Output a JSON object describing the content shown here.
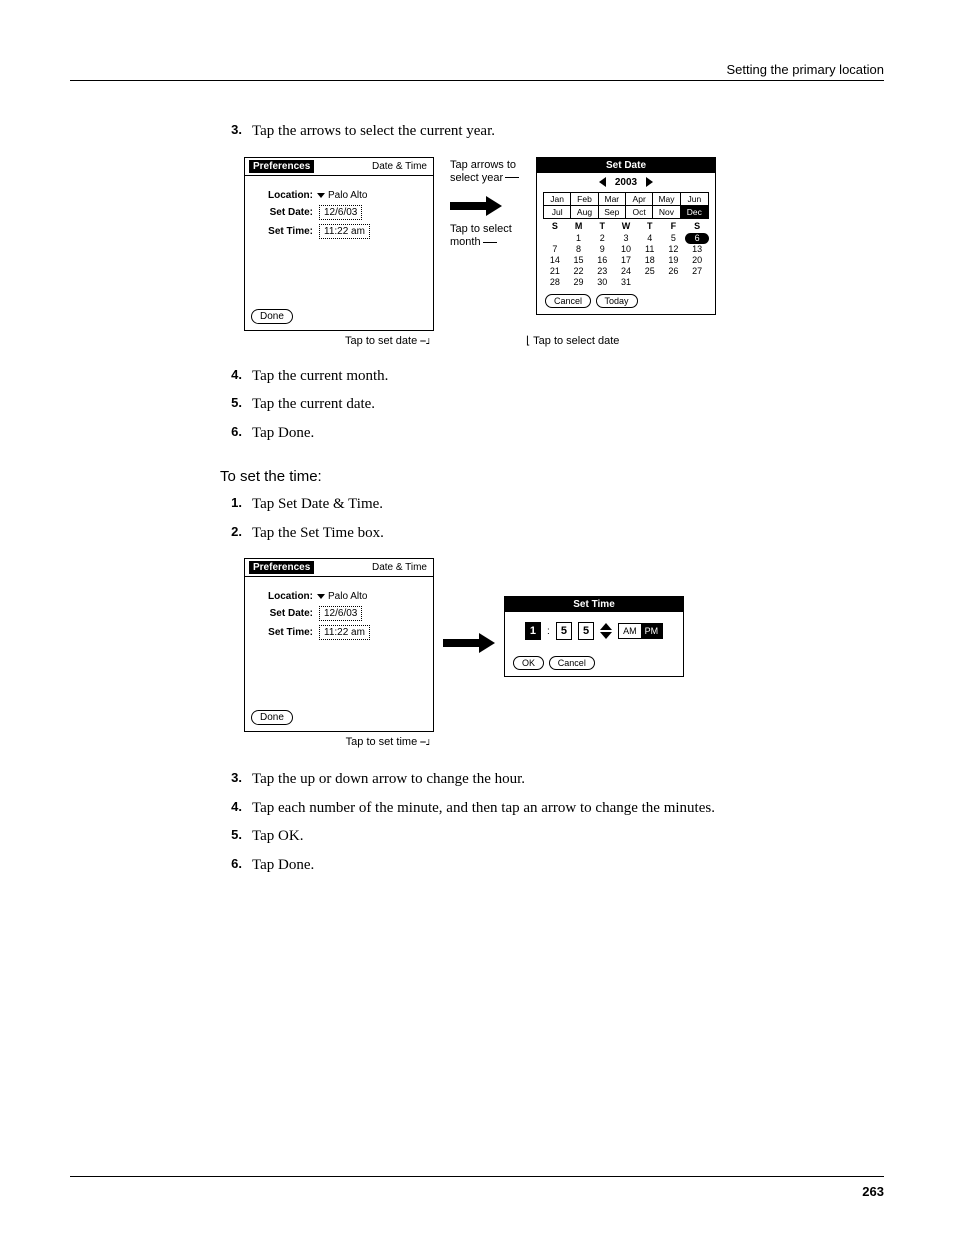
{
  "header": {
    "section": "Setting the primary location"
  },
  "steps_a": [
    {
      "n": "3.",
      "t": "Tap the arrows to select the current year."
    }
  ],
  "fig1": {
    "pref_title_left": "Preferences",
    "pref_title_right": "Date & Time",
    "location_label": "Location:",
    "location_value": "Palo Alto",
    "setdate_label": "Set Date:",
    "setdate_value": "12/6/03",
    "settime_label": "Set Time:",
    "settime_value": "11:22 am",
    "done": "Done",
    "callout_year": "Tap arrows to select year",
    "callout_month": "Tap to select month",
    "caption_left": "Tap to set date",
    "caption_right": "Tap to select date",
    "setdate_title": "Set Date",
    "year": "2003",
    "months": [
      "Jan",
      "Feb",
      "Mar",
      "Apr",
      "May",
      "Jun",
      "Jul",
      "Aug",
      "Sep",
      "Oct",
      "Nov",
      "Dec"
    ],
    "selected_month_index": 11,
    "dow": [
      "S",
      "M",
      "T",
      "W",
      "T",
      "F",
      "S"
    ],
    "calendar_rows": [
      [
        "",
        "1",
        "2",
        "3",
        "4",
        "5",
        "6"
      ],
      [
        "7",
        "8",
        "9",
        "10",
        "11",
        "12",
        "13"
      ],
      [
        "14",
        "15",
        "16",
        "17",
        "18",
        "19",
        "20"
      ],
      [
        "21",
        "22",
        "23",
        "24",
        "25",
        "26",
        "27"
      ],
      [
        "28",
        "29",
        "30",
        "31",
        "",
        "",
        ""
      ]
    ],
    "highlight_day": "6",
    "cancel": "Cancel",
    "today": "Today"
  },
  "steps_b": [
    {
      "n": "4.",
      "t": "Tap the current month."
    },
    {
      "n": "5.",
      "t": "Tap the current date."
    },
    {
      "n": "6.",
      "t": "Tap Done."
    }
  ],
  "sub_heading": "To set the time:",
  "steps_c": [
    {
      "n": "1.",
      "t": "Tap Set Date & Time."
    },
    {
      "n": "2.",
      "t": "Tap the Set Time box."
    }
  ],
  "fig2": {
    "caption": "Tap to set time",
    "settime_title": "Set Time",
    "hour": "1",
    "min1": "5",
    "min2": "5",
    "am": "AM",
    "pm": "PM",
    "ok": "OK",
    "cancel": "Cancel"
  },
  "steps_d": [
    {
      "n": "3.",
      "t": "Tap the up or down arrow to change the hour."
    },
    {
      "n": "4.",
      "t": "Tap each number of the minute, and then tap an arrow to change the minutes."
    },
    {
      "n": "5.",
      "t": "Tap OK."
    },
    {
      "n": "6.",
      "t": "Tap Done."
    }
  ],
  "page_number": "263"
}
